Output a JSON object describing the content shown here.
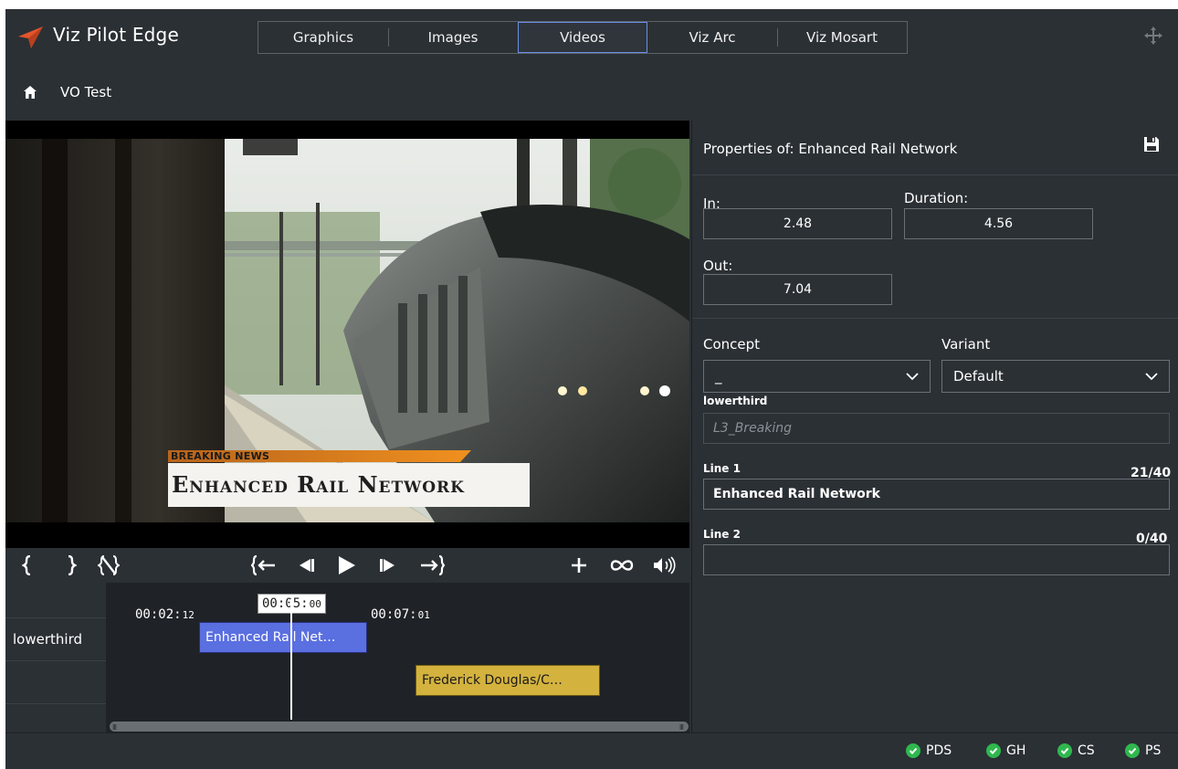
{
  "app": {
    "title": "Viz Pilot Edge",
    "accent": "#e3542b"
  },
  "tabs": [
    {
      "label": "Graphics",
      "active": false
    },
    {
      "label": "Images",
      "active": false
    },
    {
      "label": "Videos",
      "active": true
    },
    {
      "label": "Viz Arc",
      "active": false
    },
    {
      "label": "Viz Mosart",
      "active": false
    }
  ],
  "breadcrumb": {
    "icon": "home-icon",
    "label": "VO Test"
  },
  "video": {
    "overlay_kicker": "BREAKING NEWS",
    "overlay_headline": "Enhanced Rail Network"
  },
  "transport": {
    "icons": [
      "mark-in-icon",
      "mark-out-icon",
      "clear-marks-icon",
      "go-to-in-icon",
      "step-back-icon",
      "play-icon",
      "step-forward-icon",
      "go-to-out-icon",
      "add-icon",
      "loop-icon",
      "volume-icon"
    ]
  },
  "timeline": {
    "tracks": [
      {
        "label": "lowerthird"
      },
      {
        "label": ""
      },
      {
        "label": ""
      }
    ],
    "markers": {
      "in": {
        "time": "00:02:",
        "frames": "12"
      },
      "current": {
        "time": "00:05:",
        "frames": "00"
      },
      "out": {
        "time": "00:07:",
        "frames": "01"
      }
    },
    "clips": [
      {
        "label": "Enhanced Rail Net…",
        "color": "#5a6fe0"
      },
      {
        "label": "Frederick Douglas/C…",
        "color": "#d4b23e"
      }
    ]
  },
  "properties": {
    "title": "Properties of: Enhanced Rail Network",
    "in_label": "In:",
    "in_value": "2.48",
    "duration_label": "Duration:",
    "duration_value": "4.56",
    "out_label": "Out:",
    "out_value": "7.04",
    "concept_label": "Concept",
    "concept_value": "_",
    "variant_label": "Variant",
    "variant_value": "Default",
    "template_label": "lowerthird",
    "template_value": "L3_Breaking",
    "line1_label": "Line 1",
    "line1_value": "Enhanced Rail Network",
    "line1_count": "21/40",
    "line2_label": "Line 2",
    "line2_value": "",
    "line2_count": "0/40"
  },
  "status": {
    "services": [
      "PDS",
      "GH",
      "CS",
      "PS"
    ],
    "ok_color": "#2fb84e"
  }
}
